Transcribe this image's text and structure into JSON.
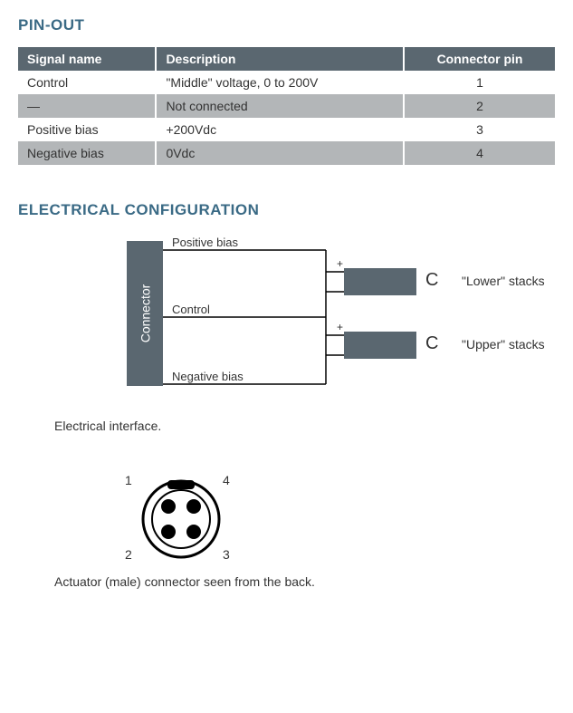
{
  "sections": {
    "pinout_title": "PIN-OUT",
    "electrical_title": "ELECTRICAL CONFIGURATION"
  },
  "table": {
    "headers": {
      "signal": "Signal name",
      "description": "Description",
      "pin": "Connector pin"
    },
    "rows": [
      {
        "signal": "Control",
        "description": "\"Middle\" voltage, 0 to 200V",
        "pin": "1"
      },
      {
        "signal": "—",
        "description": "Not connected",
        "pin": "2"
      },
      {
        "signal": "Positive bias",
        "description": "+200Vdc",
        "pin": "3"
      },
      {
        "signal": "Negative bias",
        "description": "0Vdc",
        "pin": "4"
      }
    ]
  },
  "diagram": {
    "connector_label": "Connector",
    "positive_bias": "Positive bias",
    "control": "Control",
    "negative_bias": "Negative bias",
    "plus": "+",
    "c": "C",
    "lower_stacks": "\"Lower\" stacks",
    "upper_stacks": "\"Upper\" stacks",
    "caption": "Electrical interface."
  },
  "connector_fig": {
    "pins": {
      "one": "1",
      "two": "2",
      "three": "3",
      "four": "4"
    },
    "caption": "Actuator (male) connector seen from the back."
  }
}
